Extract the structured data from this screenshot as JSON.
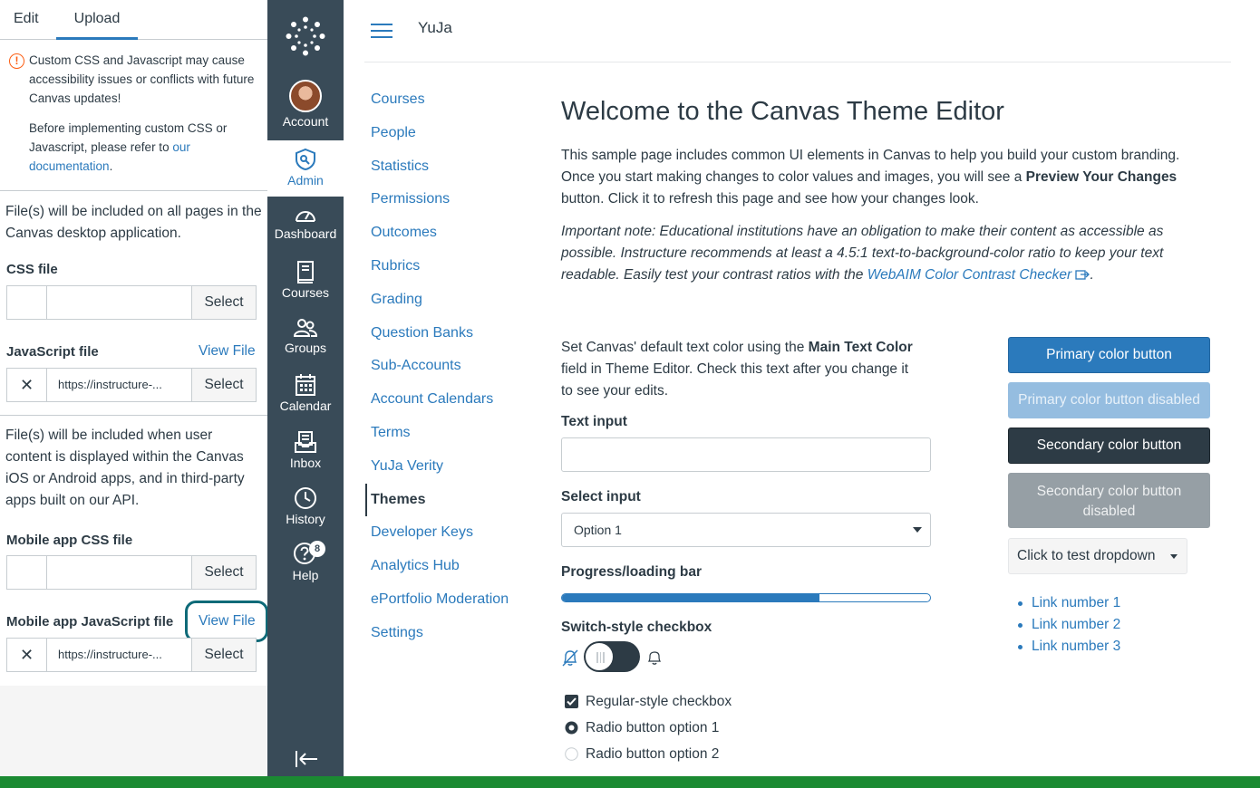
{
  "editor": {
    "tabs": [
      "Edit",
      "Upload"
    ],
    "warning": {
      "line1": "Custom CSS and Javascript may cause accessibility issues or conflicts with future Canvas updates!",
      "line2_prefix": "Before implementing custom CSS or Javascript, please refer to ",
      "line2_link": "our documentation",
      "line2_suffix": "."
    },
    "desktop_info": "File(s) will be included on all pages in the Canvas desktop application.",
    "css_file_label": "CSS file",
    "js_file_label": "JavaScript file",
    "view_file": "View File",
    "select": "Select",
    "url_value": "https://instructure-...",
    "remove_glyph": "✕",
    "mobile_info": "File(s) will be included when user content is displayed within the Canvas iOS or Android apps, and in third-party apps built on our API.",
    "mobile_css_label": "Mobile app CSS file",
    "mobile_js_label": "Mobile app JavaScript file"
  },
  "global_nav": {
    "items": [
      {
        "label": "Account",
        "icon": "avatar"
      },
      {
        "label": "Admin",
        "icon": "shield-icon"
      },
      {
        "label": "Dashboard",
        "icon": "dashboard-icon"
      },
      {
        "label": "Courses",
        "icon": "book-icon"
      },
      {
        "label": "Groups",
        "icon": "groups-icon"
      },
      {
        "label": "Calendar",
        "icon": "calendar-icon"
      },
      {
        "label": "Inbox",
        "icon": "inbox-icon"
      },
      {
        "label": "History",
        "icon": "clock-icon"
      },
      {
        "label": "Help",
        "icon": "help-icon"
      }
    ],
    "help_badge": "8"
  },
  "header": {
    "breadcrumb": "YuJa"
  },
  "sub_nav": {
    "items": [
      "Courses",
      "People",
      "Statistics",
      "Permissions",
      "Outcomes",
      "Rubrics",
      "Grading",
      "Question Banks",
      "Sub-Accounts",
      "Account Calendars",
      "Terms",
      "YuJa Verity",
      "Themes",
      "Developer Keys",
      "Analytics Hub",
      "ePortfolio Moderation",
      "Settings"
    ],
    "active": "Themes"
  },
  "main": {
    "title": "Welcome to the Canvas Theme Editor",
    "intro_1": "This sample page includes common UI elements in Canvas to help you build your custom branding. Once you start making changes to color values and images, you will see a ",
    "intro_bold": "Preview Your Changes",
    "intro_2": " button. Click it to refresh this page and see how your changes look.",
    "note": "Important note: Educational institutions have an obligation to make their content as accessible as possible. Instructure recommends at least a 4.5:1 text-to-background-color ratio to keep your text readable. Easily test your contrast ratios with the ",
    "note_link": "WebAIM Color Contrast Checker",
    "note_end": ".",
    "text_color_1": "Set Canvas' default text color using the ",
    "text_color_bold": "Main Text Color",
    "text_color_2": " field in Theme Editor. Check this text after you change it to see your edits.",
    "text_input_label": "Text input",
    "text_input_value": "",
    "select_label": "Select input",
    "select_value": "Option 1",
    "progress_label": "Progress/loading bar",
    "progress_fraction": 0.7,
    "switch_label": "Switch-style checkbox",
    "checkbox_label": "Regular-style checkbox",
    "radio_1": "Radio button option 1",
    "radio_2": "Radio button option 2"
  },
  "buttons": {
    "primary": "Primary color button",
    "primary_disabled": "Primary color button disabled",
    "secondary": "Secondary color button",
    "secondary_disabled": "Secondary color button disabled",
    "dropdown": "Click to test dropdown",
    "links": [
      "Link number 1",
      "Link number 2",
      "Link number 3"
    ]
  },
  "colors": {
    "brand": "#2b7abc",
    "nav_bg": "#394b58",
    "text": "#2d3b45",
    "warning": "#fc5e13",
    "footer": "#1b8a32",
    "focus_ring": "#0e6a78"
  }
}
